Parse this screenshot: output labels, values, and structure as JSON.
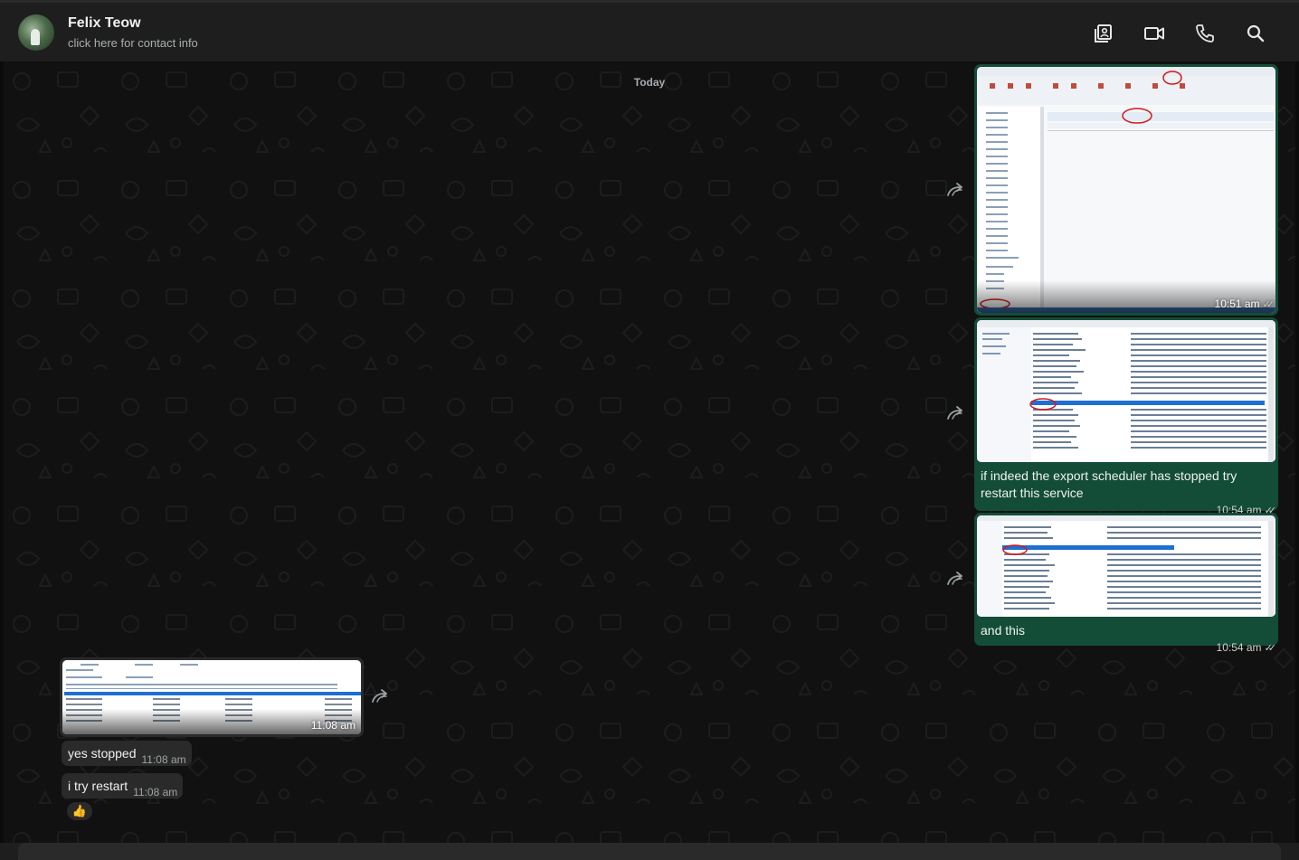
{
  "contact": {
    "name": "Felix Teow",
    "subtitle": "click here for contact info"
  },
  "header_icons": [
    "gallery-icon",
    "video-call-icon",
    "phone-icon",
    "search-icon"
  ],
  "date_divider": "Today",
  "messages": [
    {
      "direction": "outgoing",
      "type": "image",
      "time": "10:51 am",
      "status": "read"
    },
    {
      "direction": "outgoing",
      "type": "image",
      "caption": "if indeed the export scheduler has stopped try restart this service",
      "time": "10:54 am",
      "status": "read"
    },
    {
      "direction": "outgoing",
      "type": "image",
      "caption": "and this",
      "time": "10:54 am",
      "status": "read"
    },
    {
      "direction": "incoming",
      "type": "image",
      "time": "11:08 am"
    },
    {
      "direction": "incoming",
      "type": "text",
      "text": "yes stopped",
      "time": "11:08 am"
    },
    {
      "direction": "incoming",
      "type": "text",
      "text": "i try restart",
      "time": "11:08 am",
      "reaction": "👍"
    }
  ],
  "colors": {
    "outgoing_bubble": "#144d37",
    "incoming_bubble": "#2a2a2a",
    "header": "#1e1e1e",
    "chat_background": "#111111"
  }
}
